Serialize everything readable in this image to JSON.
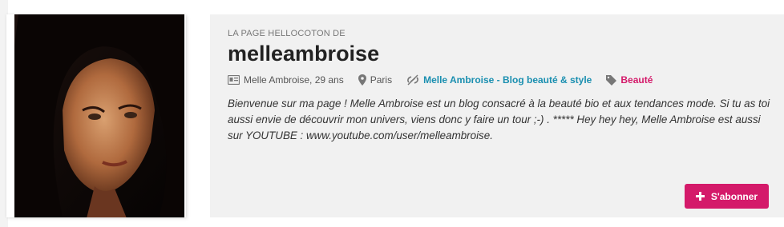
{
  "profile": {
    "kicker": "LA PAGE HELLOCOTON DE",
    "username": "melleambroise",
    "name_age": "Melle Ambroise, 29 ans",
    "location": "Paris",
    "blog_link": "Melle Ambroise - Blog beauté & style",
    "category": "Beauté",
    "bio": "Bienvenue sur ma page ! Melle Ambroise est un blog consacré à la beauté bio et aux tendances mode. Si tu as toi aussi envie de découvrir mon univers, viens donc y faire un tour ;-) . ***** Hey hey hey, Melle Ambroise est aussi sur YOUTUBE : www.youtube.com/user/melleambroise.",
    "subscribe_label": "S'abonner"
  },
  "colors": {
    "accent": "#d41a6a",
    "link": "#1a8fb0",
    "panel_bg": "#f1f1f1"
  },
  "icons": {
    "id_card": "id-card-icon",
    "location": "map-pin-icon",
    "link": "link-icon",
    "tag": "tag-icon",
    "plus": "plus-icon"
  }
}
